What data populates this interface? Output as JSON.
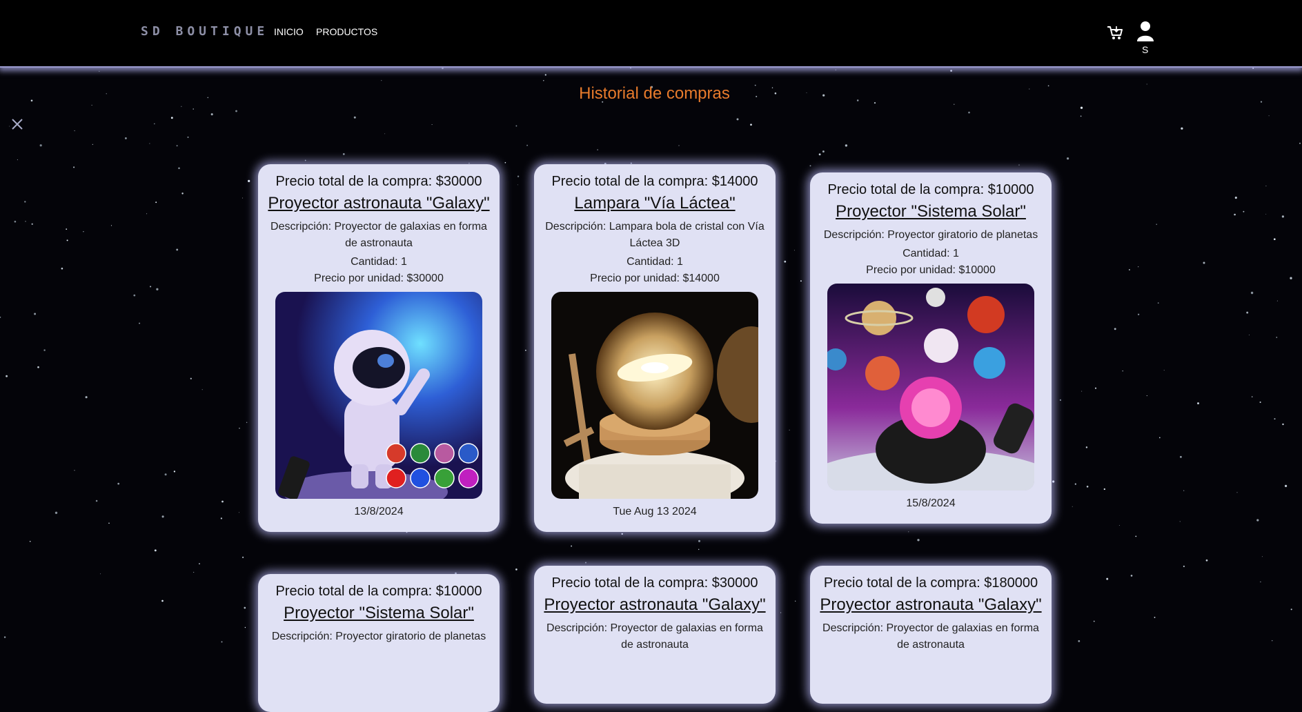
{
  "header": {
    "brand": "SD BOUTIQUE",
    "nav": [
      "INICIO",
      "PRODUCTOS"
    ],
    "user_initial": "S"
  },
  "page_title": "Historial de compras",
  "purchases": [
    {
      "total": "Precio total de la compra: $30000",
      "name": "Proyector astronauta \"Galaxy\"",
      "description": "Descripción: Proyector de galaxias en forma de astronauta",
      "quantity": "Cantidad: 1",
      "unit_price": "Precio por unidad: $30000",
      "image": "astronaut-projector-image",
      "date": "13/8/2024"
    },
    {
      "total": "Precio total de la compra: $14000",
      "name": "Lampara \"Vía Láctea\"",
      "description": "Descripción: Lampara bola de cristal con Vía Láctea 3D",
      "quantity": "Cantidad: 1",
      "unit_price": "Precio por unidad: $14000",
      "image": "crystal-ball-lamp-image",
      "date": "Tue Aug 13 2024"
    },
    {
      "total": "Precio total de la compra: $10000",
      "name": "Proyector \"Sistema Solar\"",
      "description": "Descripción: Proyector giratorio de planetas",
      "quantity": "Cantidad: 1",
      "unit_price": "Precio por unidad: $10000",
      "image": "solar-system-projector-image",
      "date": "15/8/2024"
    },
    {
      "total": "Precio total de la compra: $10000",
      "name": "Proyector \"Sistema Solar\"",
      "description": "Descripción: Proyector giratorio de planetas"
    },
    {
      "total": "Precio total de la compra: $30000",
      "name": "Proyector astronauta \"Galaxy\"",
      "description": "Descripción: Proyector de galaxias en forma de astronauta"
    },
    {
      "total": "Precio total de la compra: $180000",
      "name": "Proyector astronauta \"Galaxy\"",
      "description": "Descripción: Proyector de galaxias en forma de astronauta"
    }
  ],
  "colors": {
    "title": "#e87b2c",
    "card": "#e0e1f4",
    "glow": "#bebeff",
    "background": "#040409"
  }
}
